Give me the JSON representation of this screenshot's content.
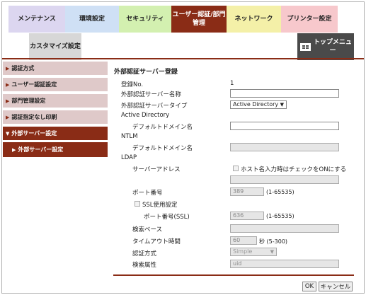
{
  "tabs": {
    "maintenance": "メンテナンス",
    "environment": "環境設定",
    "security": "セキュリティ",
    "auth_line1": "ユーザー認証/部門",
    "auth_line2": "管理",
    "network": "ネットワーク",
    "printer": "プリンター設定",
    "customize": "カスタマイズ設定",
    "top_menu_line1": "トップメニュ",
    "top_menu_line2": "ー"
  },
  "sidebar": {
    "items": [
      {
        "label": "認証方式"
      },
      {
        "label": "ユーザー認証設定"
      },
      {
        "label": "部門管理設定"
      },
      {
        "label": "認証指定なし印刷"
      },
      {
        "label": "外部サーバー設定"
      }
    ],
    "sub_item": "外部サーバー設定"
  },
  "main": {
    "title": "外部認証サーバー登録",
    "reg_no_label": "登録No.",
    "reg_no_value": "1",
    "server_name_label": "外部認証サーバー名称",
    "server_type_label": "外部認証サーバータイプ",
    "server_type_value": "Active Directory",
    "ad_section": "Active Directory",
    "ad_domain_label": "デフォルトドメイン名",
    "ntlm_section": "NTLM",
    "ntlm_domain_label": "デフォルトドメイン名",
    "ldap_section": "LDAP",
    "server_address_label": "サーバーアドレス",
    "host_check_label": "ホスト名入力時はチェックをONにする",
    "port_label": "ポート番号",
    "port_value": "389",
    "port_range": "(1-65535)",
    "ssl_label": "SSL使用設定",
    "ssl_port_label": "ポート番号(SSL)",
    "ssl_port_value": "636",
    "ssl_port_range": "(1-65535)",
    "search_base_label": "検索ベース",
    "timeout_label": "タイムアウト時間",
    "timeout_value": "60",
    "timeout_unit": "秒 (5-300)",
    "auth_method_label": "認証方式",
    "auth_method_value": "Simple",
    "search_attr_label": "検索属性",
    "search_attr_value": "uid"
  },
  "buttons": {
    "ok": "OK",
    "cancel": "キャンセル"
  },
  "colors": {
    "accent": "#8a2c16",
    "sidebar_inactive": "#dfc9c9"
  }
}
